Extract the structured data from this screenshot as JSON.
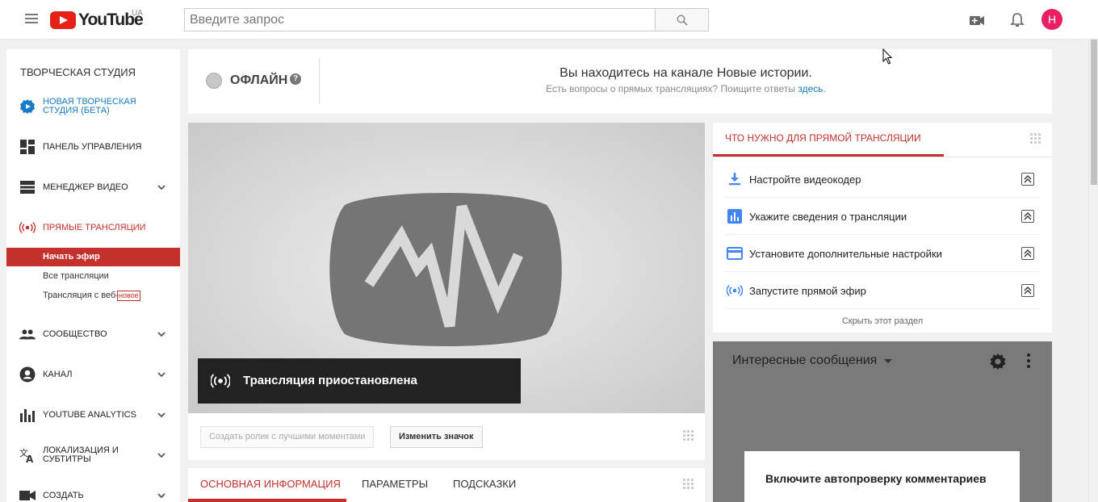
{
  "topbar": {
    "logo_text": "YouTube",
    "region": "UA",
    "search_placeholder": "Введите запрос",
    "avatar_letter": "Н",
    "icons": [
      "menu-icon",
      "search-icon",
      "video-camera-icon",
      "bell-icon"
    ]
  },
  "sidebar": {
    "title": "ТВОРЧЕСКАЯ СТУДИЯ",
    "new_studio": "НОВАЯ ТВОРЧЕСКАЯ СТУДИЯ (БЕТА)",
    "dashboard": "ПАНЕЛЬ УПРАВЛЕНИЯ",
    "video_manager": "МЕНЕДЖЕР ВИДЕО",
    "live": "ПРЯМЫЕ ТРАНСЛЯЦИИ",
    "live_sub": {
      "start": "Начать эфир",
      "all": "Все трансляции",
      "webcam_prefix": "Трансляция с веб-",
      "webcam_tag": "новое"
    },
    "community": "СООБЩЕСТВО",
    "channel": "КАНАЛ",
    "analytics": "YOUTUBE ANALYTICS",
    "localization_line1": "ЛОКАЛИЗАЦИЯ И",
    "localization_line2": "СУБТИТРЫ",
    "create": "СОЗДАТЬ",
    "accent_color": "#c4302b",
    "link_color": "#167ac6"
  },
  "header": {
    "status": "ОФЛАЙН",
    "channel_text": "Вы находитесь на канале Новые истории.",
    "help_text": "Есть вопросы о прямых трансляциях? Поищите ответы ",
    "help_link": "здесь",
    "help_end": "."
  },
  "preview": {
    "paused_text": "Трансляция приостановлена",
    "highlight_button": "Создать ролик с лучшими моментами",
    "change_thumbnail_button": "Изменить значок"
  },
  "tabs": {
    "basic": "ОСНОВНАЯ ИНФОРМАЦИЯ",
    "params": "ПАРАМЕТРЫ",
    "hints": "ПОДСКАЗКИ"
  },
  "requirements": {
    "title": "ЧТО НУЖНО ДЛЯ ПРЯМОЙ ТРАНСЛЯЦИИ",
    "items": [
      {
        "label": "Настройте видеокодер",
        "icon": "download-icon"
      },
      {
        "label": "Укажите сведения о трансляции",
        "icon": "bar-chart-icon"
      },
      {
        "label": "Установите дополнительные настройки",
        "icon": "card-icon"
      },
      {
        "label": "Запустите прямой эфир",
        "icon": "broadcast-icon"
      }
    ],
    "hide_link": "Скрыть этот раздел"
  },
  "chat": {
    "title": "Интересные сообщения",
    "notice": "Включите автопроверку комментариев"
  }
}
